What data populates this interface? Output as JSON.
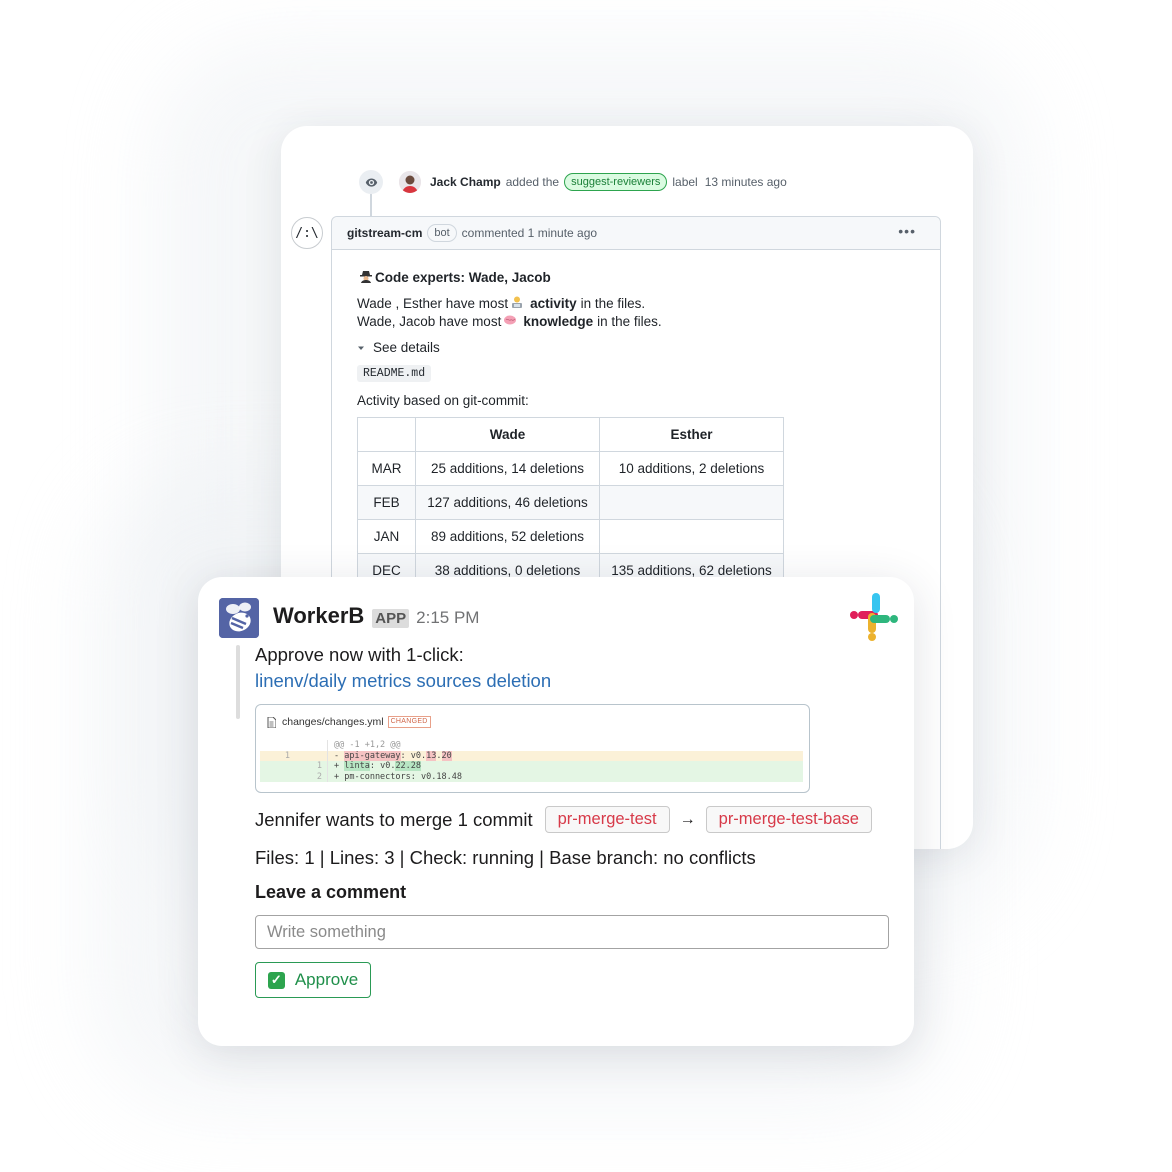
{
  "github": {
    "event": {
      "actor": "Jack Champ",
      "action": "added the",
      "label": "suggest-reviewers",
      "suffix": "label",
      "time": "13 minutes ago"
    },
    "comment": {
      "bot_avatar_glyph": "/:\\",
      "author": "gitstream-cm",
      "badge": "bot",
      "meta": "commented 1 minute ago",
      "menu_glyph": "•••",
      "title": "Code experts: Wade, Jacob",
      "line1_prefix": "Wade , Esther have most",
      "line1_bold": "activity",
      "line1_suffix": "in the files.",
      "line2_prefix": "Wade, Jacob have most",
      "line2_bold": "knowledge",
      "line2_suffix": "in the files.",
      "see_details": "See details",
      "file_name": "README.md",
      "activity_caption": "Activity based on git-commit:",
      "table": {
        "headers": [
          "",
          "Wade",
          "Esther"
        ],
        "rows": [
          [
            "MAR",
            "25 additions, 14 deletions",
            "10 additions, 2 deletions"
          ],
          [
            "FEB",
            "127 additions, 46 deletions",
            ""
          ],
          [
            "JAN",
            "89 additions, 52 deletions",
            ""
          ],
          [
            "DEC",
            "38 additions, 0 deletions",
            "135 additions, 62 deletions"
          ]
        ]
      }
    }
  },
  "slack": {
    "sender": "WorkerB",
    "app_badge": "APP",
    "time": "2:15 PM",
    "approve_text": "Approve now with 1-click:",
    "pr_link": "linenv/daily metrics sources deletion",
    "diff": {
      "file_name": "changes/changes.yml",
      "status": "CHANGED",
      "hunk": "@@ -1 +1,2 @@",
      "del_line_no": "1",
      "del_marker": "-",
      "del_key": "api-gateway",
      "del_sep": ": v0.",
      "del_hl": "13",
      "del_dot": ".",
      "del_hl2": "20",
      "add1_line_no": "1",
      "add1_marker": "+",
      "add1_key": "linta",
      "add1_sep": ": v0.",
      "add1_hl": "22.28",
      "add2_line_no": "2",
      "add2_text": "+ pm-connectors: v0.18.48"
    },
    "merge_text": "Jennifer wants to merge 1 commit",
    "source_branch": "pr-merge-test",
    "arrow": "→",
    "target_branch": "pr-merge-test-base",
    "files_text": "Files: 1 | Lines: 3 | Check: running | Base branch: no conflicts",
    "leave_comment_title": "Leave a comment",
    "comment_placeholder": "Write something",
    "approve_check": "✓",
    "approve_label": "Approve"
  }
}
